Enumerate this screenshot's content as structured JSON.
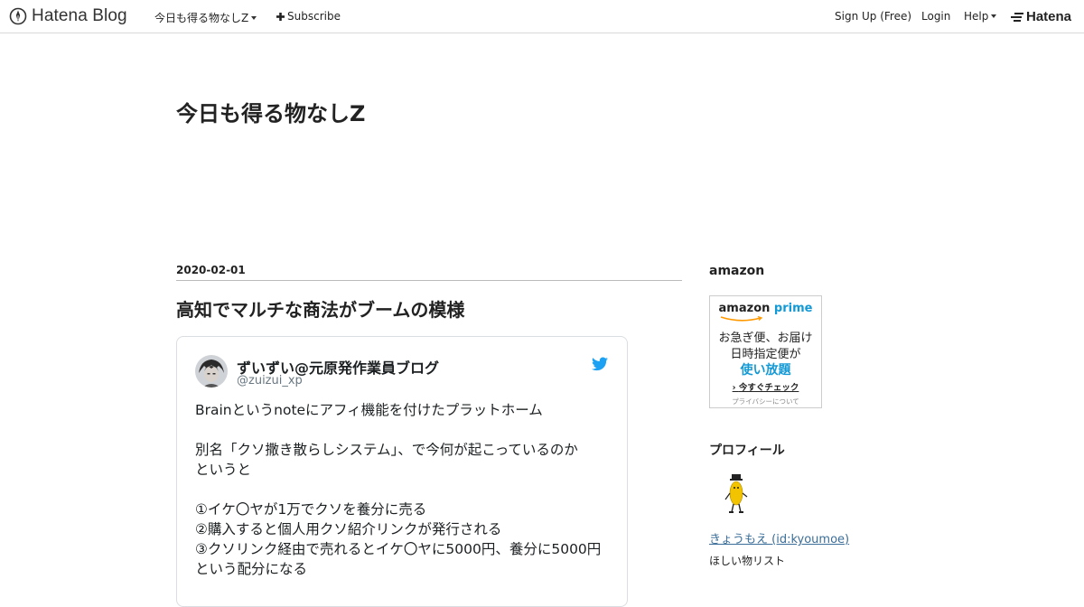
{
  "globalheader": {
    "logo_text": "Hatena Blog",
    "blog_menu_label": "今日も得る物なしZ",
    "subscribe_label": "Subscribe",
    "signup_label": "Sign Up (Free)",
    "login_label": "Login",
    "help_label": "Help",
    "hatena_label": "Hatena"
  },
  "blog": {
    "title": "今日も得る物なしZ"
  },
  "entry": {
    "date": "2020-02-01",
    "title": "高知でマルチな商法がブームの模様"
  },
  "tweet": {
    "name": "ずいずい@元原発作業員ブログ",
    "handle": "@zuizui_xp",
    "lines": [
      "Brainというnoteにアフィ機能を付けたプラットホーム",
      "",
      "別名「クソ撒き散らしシステム」、で今何が起こっているのか",
      "というと",
      "",
      "①イケ〇ヤが1万でクソを養分に売る",
      "②購入すると個人用クソ紹介リンクが発行される",
      "③クソリンク経由で売れるとイケ〇ヤに5000円、養分に5000円",
      "という配分になる"
    ]
  },
  "sidebar": {
    "amazon_heading": "amazon",
    "amazon_ad": {
      "logo_amazon": "amazon",
      "logo_prime": "prime",
      "line1": "お急ぎ便、お届け",
      "line2": "日時指定便が",
      "line3": "使い放題",
      "cta": "今すぐチェック",
      "privacy": "プライバシーについて"
    },
    "profile_heading": "プロフィール",
    "profile_name": "きょうもえ (id:kyoumoe)",
    "wishlist": "ほしい物リスト"
  },
  "colors": {
    "link": "#3b6e98",
    "twitter_blue": "#1da1f2",
    "prime_blue": "#1399d6"
  }
}
